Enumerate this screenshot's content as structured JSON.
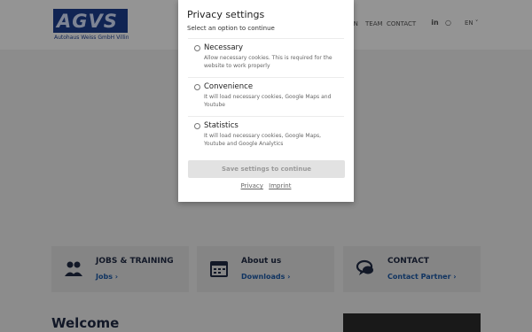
{
  "header": {
    "logo_text": "AGVS",
    "logo_subtitle": "Autohaus Weiss GmbH Villingen",
    "nav": [
      "...N",
      "TEAM",
      "CONTACT"
    ],
    "social": {
      "linkedin": "in",
      "instagram": "○"
    },
    "language": "EN ˅"
  },
  "cards": [
    {
      "title": "JOBS & TRAINING",
      "link": "Jobs ›",
      "icon": "people-icon"
    },
    {
      "title": "About us",
      "link": "Downloads ›",
      "icon": "calendar-icon"
    },
    {
      "title": "CONTACT",
      "link": "Contact Partner ›",
      "icon": "chat-icon"
    }
  ],
  "welcome": "Welcome",
  "modal": {
    "title": "Privacy settings",
    "subtitle": "Select an option to continue",
    "options": [
      {
        "label": "Necessary",
        "desc": "Allow necessary cookies. This is required for the website to work properly"
      },
      {
        "label": "Convenience",
        "desc": "It will load necessary cookies, Google Maps and Youtube"
      },
      {
        "label": "Statistics",
        "desc": "It will load necessary cookies, Google Maps, Youtube and Google Analytics"
      }
    ],
    "save_label": "Save settings to continue",
    "privacy_link": "Privacy",
    "imprint_link": "Imprint"
  },
  "colors": {
    "brand": "#1d3f8f",
    "link": "#1d5aa8",
    "overlay": "rgba(0,0,0,0.42)"
  }
}
